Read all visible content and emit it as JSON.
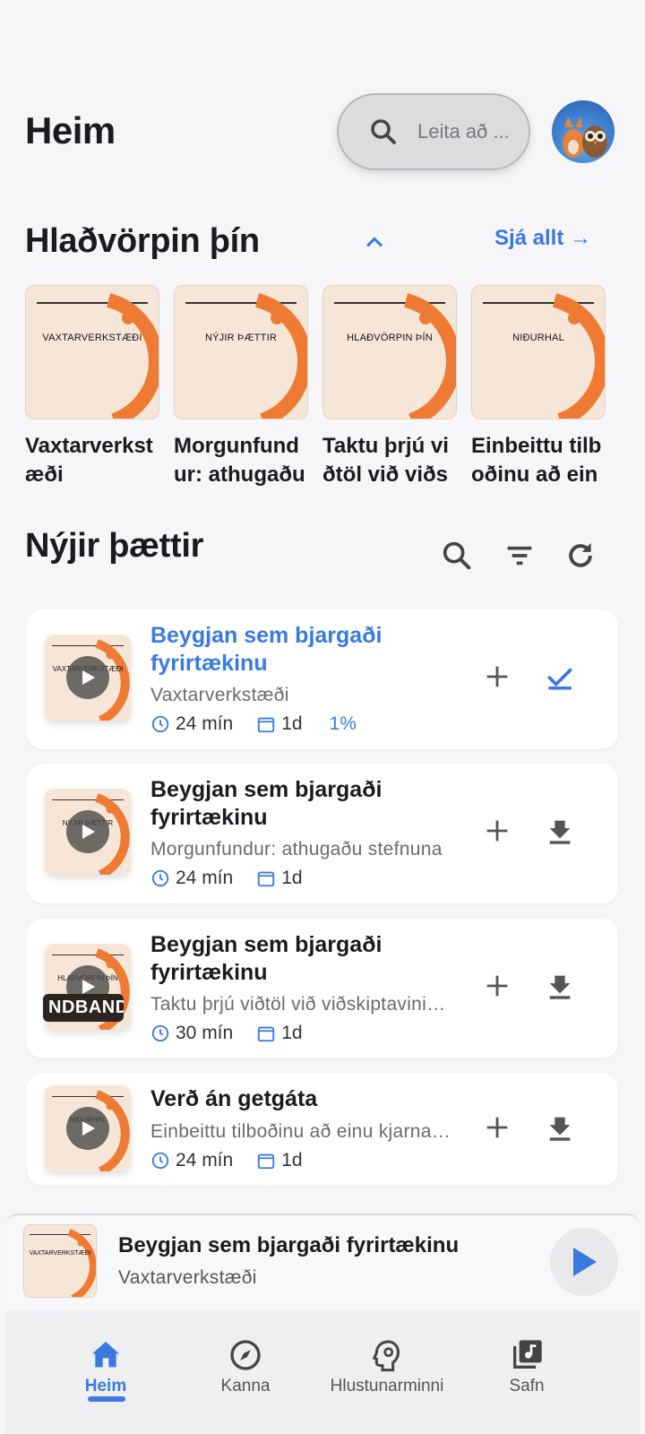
{
  "header": {
    "title": "Heim",
    "search_placeholder": "Leita að ..."
  },
  "podcasts_section": {
    "title": "Hlaðvörpin þín",
    "see_all": "Sjá allt →",
    "items": [
      {
        "cover_title": "VAXTARVERKSTÆÐI",
        "name": "Vaxtarverkstæði"
      },
      {
        "cover_title": "NÝJIR ÞÆTTIR",
        "name": "Morgunfundur: athugaðu stefnuna"
      },
      {
        "cover_title": "HLAÐVÖRPIN ÞÍN",
        "name": "Taktu þrjú viðtöl við viðskiptavini"
      },
      {
        "cover_title": "NIÐURHAL",
        "name": "Einbeittu tilboðinu að einu kjarna"
      }
    ]
  },
  "episodes_section": {
    "title": "Nýjir þættir",
    "episodes": [
      {
        "cover_title": "VAXTARVERKSTÆÐI",
        "title": "Beygjan sem bjargaði fyrirtækinu",
        "podcast": "Vaxtarverkstæði",
        "duration": "24 mín",
        "date": "1d",
        "progress": "1%",
        "action": "check-icon",
        "active": true
      },
      {
        "cover_title": "NÝJIR ÞÆTTIR",
        "title": "Beygjan sem bjargaði fyrirtækinu",
        "podcast": "Morgunfundur: athugaðu stefnuna",
        "duration": "24 mín",
        "date": "1d",
        "action": "download-icon"
      },
      {
        "cover_title": "HLAÐVÖRPIN ÞÍN",
        "badge": "NDBAND",
        "title": "Beygjan sem bjargaði fyrirtækinu",
        "podcast": "Taktu þrjú viðtöl við viðskiptavini…",
        "duration": "30 mín",
        "date": "1d",
        "action": "download-icon"
      },
      {
        "cover_title": "NIÐURHAL",
        "title": "Verð án getgáta",
        "podcast": "Einbeittu tilboðinu að einu kjarna…",
        "duration": "24 mín",
        "date": "1d",
        "action": "download-icon"
      }
    ]
  },
  "mini_player": {
    "cover_title": "VAXTARVERKSTÆÐI",
    "title": "Beygjan sem bjargaði fyrirtækinu",
    "podcast": "Vaxtarverkstæði"
  },
  "nav": {
    "items": [
      {
        "label": "Heim",
        "icon": "home-icon",
        "active": true
      },
      {
        "label": "Kanna",
        "icon": "compass-icon"
      },
      {
        "label": "Hlustunarminni",
        "icon": "brain-icon"
      },
      {
        "label": "Safn",
        "icon": "library-icon"
      }
    ]
  },
  "colors": {
    "accent": "#3a7ae0",
    "cover_bg": "#f6e6d7",
    "cover_arc": "#ee7a33"
  }
}
